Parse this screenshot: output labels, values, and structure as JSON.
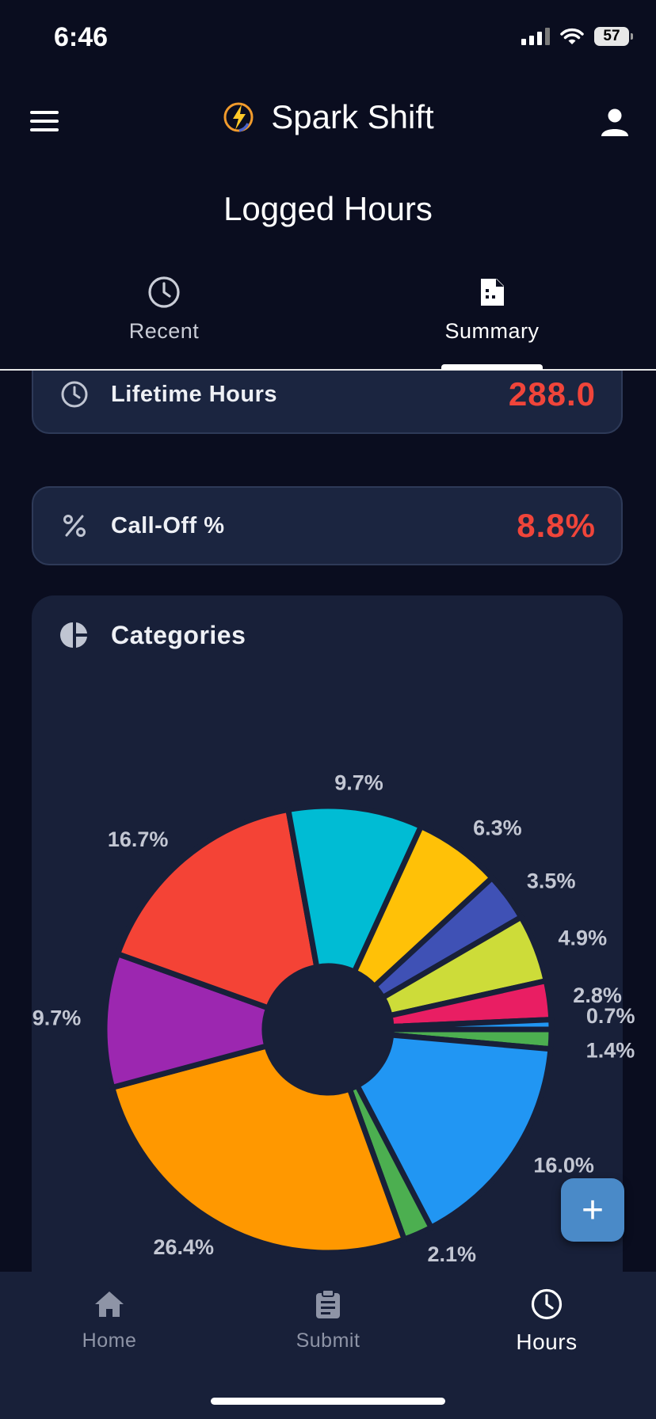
{
  "status_bar": {
    "time": "6:46",
    "battery": "57"
  },
  "header": {
    "app_title": "Spark Shift",
    "page_title": "Logged Hours"
  },
  "tabs": [
    {
      "label": "Recent",
      "icon": "clock-icon",
      "active": false
    },
    {
      "label": "Summary",
      "icon": "document-icon",
      "active": true
    }
  ],
  "stats": {
    "lifetime_label": "Lifetime Hours",
    "lifetime_value": "288.0",
    "calloff_label": "Call-Off %",
    "calloff_value": "8.8%",
    "value_color": "#f0453a"
  },
  "categories": {
    "title": "Categories"
  },
  "chart_data": {
    "type": "pie",
    "donut": true,
    "values": [
      1.4,
      16.0,
      2.1,
      26.4,
      9.7,
      16.7,
      9.7,
      6.3,
      3.5,
      4.9,
      2.8,
      0.7
    ],
    "labels": [
      "1.4%",
      "16.0%",
      "2.1%",
      "26.4%",
      "9.7%",
      "16.7%",
      "9.7%",
      "6.3%",
      "3.5%",
      "4.9%",
      "2.8%",
      "0.7%"
    ],
    "colors": [
      "#4caf50",
      "#2196f3",
      "#4caf50",
      "#ff9800",
      "#9c27b0",
      "#f44336",
      "#00bcd4",
      "#ffc107",
      "#3f51b5",
      "#cddc39",
      "#e91e63",
      "#2196f3"
    ]
  },
  "fab": {
    "label": "+"
  },
  "bottom_nav": [
    {
      "label": "Home",
      "icon": "home-icon",
      "active": false
    },
    {
      "label": "Submit",
      "icon": "clipboard-icon",
      "active": false
    },
    {
      "label": "Hours",
      "icon": "clock-icon",
      "active": true
    }
  ]
}
